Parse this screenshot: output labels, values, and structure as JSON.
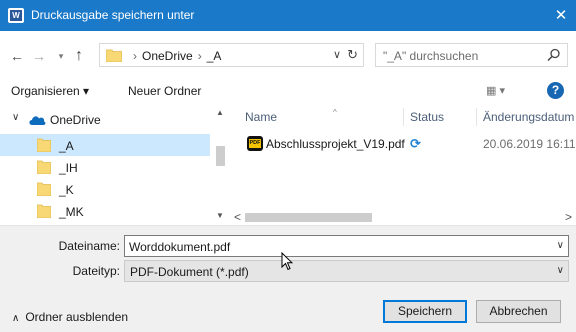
{
  "window": {
    "title": "Druckausgabe speichern unter",
    "app_icon_letter": "W",
    "close_glyph": "✕"
  },
  "navigation": {
    "back_glyph": "←",
    "forward_glyph": "→",
    "recent_glyph": "▾",
    "up_glyph": "↑",
    "breadcrumb": [
      "OneDrive",
      "_A"
    ],
    "breadcrumb_separator": "›",
    "address_dropdown_glyph": "∨",
    "refresh_glyph": "↻",
    "search_placeholder": "\"_A\" durchsuchen"
  },
  "toolbar": {
    "organize_label": "Organisieren ▾",
    "new_folder_label": "Neuer Ordner",
    "view_label": "▦ ▾",
    "help_label": "?"
  },
  "sidebar": {
    "root": {
      "label": "OneDrive",
      "expand_glyph": "∨",
      "icon": "cloud-icon"
    },
    "items": [
      {
        "label": "_A",
        "selected": true,
        "icon": "folder-icon"
      },
      {
        "label": "_IH",
        "selected": false,
        "icon": "folder-icon"
      },
      {
        "label": "_K",
        "selected": false,
        "icon": "folder-icon"
      },
      {
        "label": "_MK",
        "selected": false,
        "icon": "folder-icon"
      }
    ],
    "scroll_up_glyph": "▲",
    "scroll_down_glyph": "▼"
  },
  "file_list": {
    "columns": [
      "Name",
      "Status",
      "Änderungsdatum"
    ],
    "sort_glyph": "^",
    "rows": [
      {
        "name": "Abschlussprojekt_V19.pdf",
        "icon_text": "PDF",
        "status": "⟳",
        "modified": "20.06.2019 16:11"
      }
    ],
    "scroll_left_glyph": "<",
    "scroll_right_glyph": ">"
  },
  "form": {
    "filename_label": "Dateiname:",
    "filename_value": "Worddokument.pdf",
    "filetype_label": "Dateityp:",
    "filetype_value": "PDF-Dokument (*.pdf)",
    "dropdown_glyph": "∨"
  },
  "footer": {
    "hide_folders_caret": "∧",
    "hide_folders_label": "Ordner ausblenden",
    "save_label": "Speichern",
    "cancel_label": "Abbrechen"
  },
  "colors": {
    "titlebar": "#1a79c8",
    "selection": "#cce8ff",
    "folder": "#f8d775",
    "accent": "#0078d7"
  }
}
